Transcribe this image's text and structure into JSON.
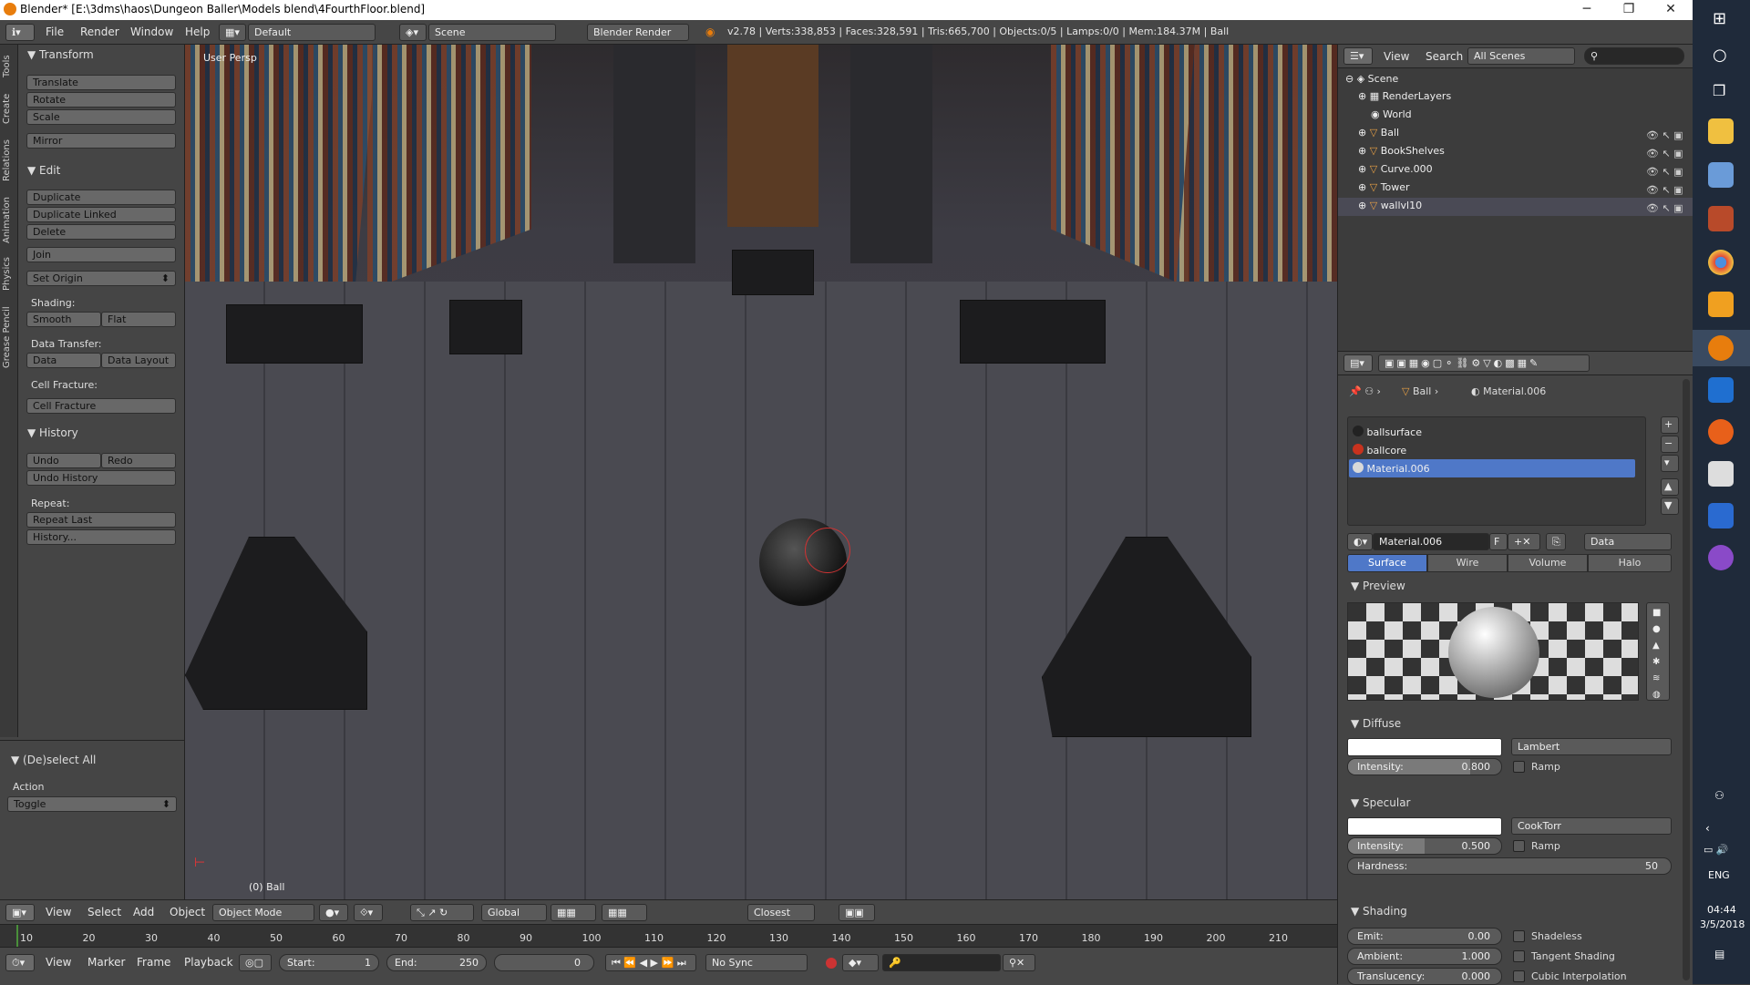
{
  "window": {
    "title": "Blender* [E:\\3dms\\haos\\Dungeon Baller\\Models blend\\4FourthFloor.blend]"
  },
  "menubar": {
    "items": [
      "File",
      "Render",
      "Window",
      "Help"
    ],
    "layout": "Default",
    "scene": "Scene",
    "engine": "Blender Render",
    "stats": "v2.78 | Verts:338,853 | Faces:328,591 | Tris:665,700 | Objects:0/5 | Lamps:0/0 | Mem:184.37M | Ball"
  },
  "vtabs": [
    "Tools",
    "Create",
    "Relations",
    "Animation",
    "Physics",
    "Grease Pencil"
  ],
  "toolshelf": {
    "transform": {
      "header": "Transform",
      "buttons": [
        "Translate",
        "Rotate",
        "Scale",
        "Mirror"
      ]
    },
    "edit": {
      "header": "Edit",
      "buttons": [
        "Duplicate",
        "Duplicate Linked",
        "Delete",
        "Join"
      ],
      "set_origin": "Set Origin",
      "shading_label": "Shading:",
      "smooth": "Smooth",
      "flat": "Flat",
      "data_transfer_label": "Data Transfer:",
      "data": "Data",
      "data_layout": "Data Layout",
      "cell_fracture_label": "Cell Fracture:",
      "cell_fracture": "Cell Fracture"
    },
    "history": {
      "header": "History",
      "undo": "Undo",
      "redo": "Redo",
      "undo_history": "Undo History",
      "repeat_label": "Repeat:",
      "repeat_last": "Repeat Last",
      "history": "History..."
    },
    "operator": {
      "header": "(De)select All",
      "action_label": "Action",
      "action_value": "Toggle"
    }
  },
  "viewport": {
    "view_label": "User Persp",
    "object_label": "(0) Ball"
  },
  "header3d": {
    "menus": [
      "View",
      "Select",
      "Add",
      "Object"
    ],
    "mode": "Object Mode",
    "orientation": "Global",
    "snap": "Closest"
  },
  "timeline": {
    "ticks": [
      "10",
      "20",
      "30",
      "40",
      "50",
      "60",
      "70",
      "80",
      "90",
      "100",
      "110",
      "120",
      "130",
      "140",
      "150",
      "160",
      "170",
      "180",
      "190",
      "200",
      "210"
    ],
    "menus": [
      "View",
      "Marker",
      "Frame",
      "Playback"
    ],
    "start_label": "Start:",
    "start": "1",
    "end_label": "End:",
    "end": "250",
    "current": "0",
    "sync": "No Sync"
  },
  "outliner": {
    "menus": [
      "View",
      "Search"
    ],
    "filter": "All Scenes",
    "items": [
      "Scene",
      "RenderLayers",
      "World",
      "Ball",
      "BookShelves",
      "Curve.000",
      "Tower",
      "wallvl10"
    ]
  },
  "properties": {
    "breadcrumb": {
      "object": "Ball",
      "material": "Material.006"
    },
    "slots": [
      "ballsurface",
      "ballcore",
      "Material.006"
    ],
    "slot_colors": [
      "#222222",
      "#c8321e",
      "#d9d9d9"
    ],
    "material_name": "Material.006",
    "fake_user": "F",
    "link": "Data",
    "tabs": [
      "Surface",
      "Wire",
      "Volume",
      "Halo"
    ],
    "preview_header": "Preview",
    "diffuse": {
      "header": "Diffuse",
      "shader": "Lambert",
      "intensity_label": "Intensity:",
      "intensity": "0.800",
      "intensity_value": 0.8,
      "ramp": "Ramp"
    },
    "specular": {
      "header": "Specular",
      "shader": "CookTorr",
      "intensity_label": "Intensity:",
      "intensity": "0.500",
      "intensity_value": 0.5,
      "ramp": "Ramp",
      "hardness_label": "Hardness:",
      "hardness": "50"
    },
    "shading": {
      "header": "Shading",
      "emit_label": "Emit:",
      "emit": "0.00",
      "ambient_label": "Ambient:",
      "ambient": "1.000",
      "translucency_label": "Translucency:",
      "translucency": "0.000",
      "shadeless": "Shadeless",
      "tangent": "Tangent Shading",
      "cubic": "Cubic Interpolation"
    }
  },
  "taskbar": {
    "lang": "ENG",
    "time": "04:44",
    "date": "3/5/2018",
    "accent": "#1f2a3a"
  }
}
